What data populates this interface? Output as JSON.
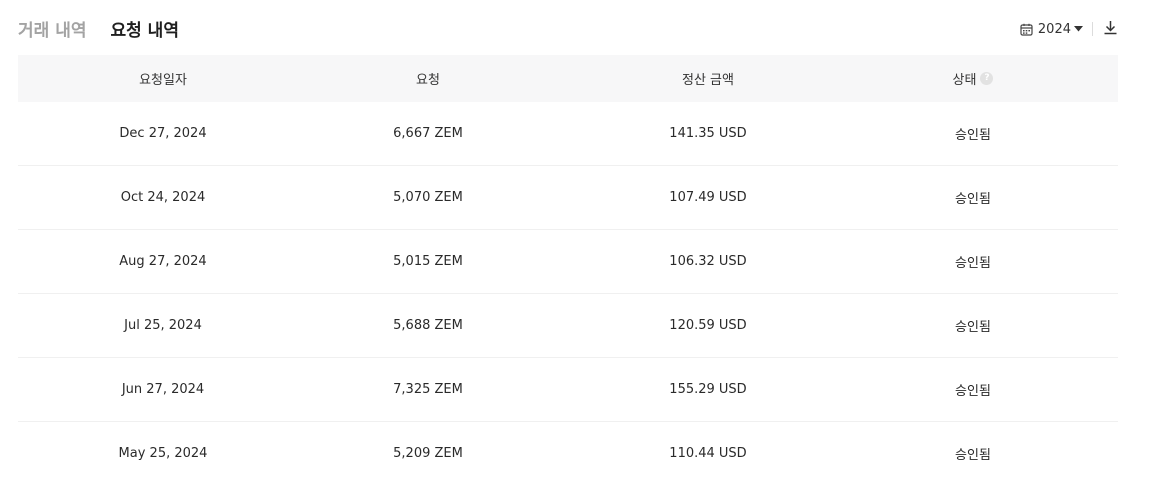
{
  "tabs": [
    {
      "label": "거래 내역",
      "active": false
    },
    {
      "label": "요청 내역",
      "active": true
    }
  ],
  "toolbar": {
    "year": "2024",
    "calendar_icon": "calendar-icon",
    "dropdown_icon": "caret-down-icon",
    "download_icon": "download-icon"
  },
  "table": {
    "headers": [
      "요청일자",
      "요청",
      "정산 금액",
      "상태"
    ],
    "rows": [
      {
        "date": "Dec 27, 2024",
        "request": "6,667 ZEM",
        "amount": "141.35 USD",
        "status": "승인됨"
      },
      {
        "date": "Oct 24, 2024",
        "request": "5,070 ZEM",
        "amount": "107.49 USD",
        "status": "승인됨"
      },
      {
        "date": "Aug 27, 2024",
        "request": "5,015 ZEM",
        "amount": "106.32 USD",
        "status": "승인됨"
      },
      {
        "date": "Jul 25, 2024",
        "request": "5,688 ZEM",
        "amount": "120.59 USD",
        "status": "승인됨"
      },
      {
        "date": "Jun 27, 2024",
        "request": "7,325 ZEM",
        "amount": "155.29 USD",
        "status": "승인됨"
      },
      {
        "date": "May 25, 2024",
        "request": "5,209 ZEM",
        "amount": "110.44 USD",
        "status": "승인됨"
      }
    ]
  },
  "colors": {
    "header_bg": "#f7f7f8",
    "active_tab": "#1f1f1f",
    "inactive_tab": "#a3a3a3"
  }
}
